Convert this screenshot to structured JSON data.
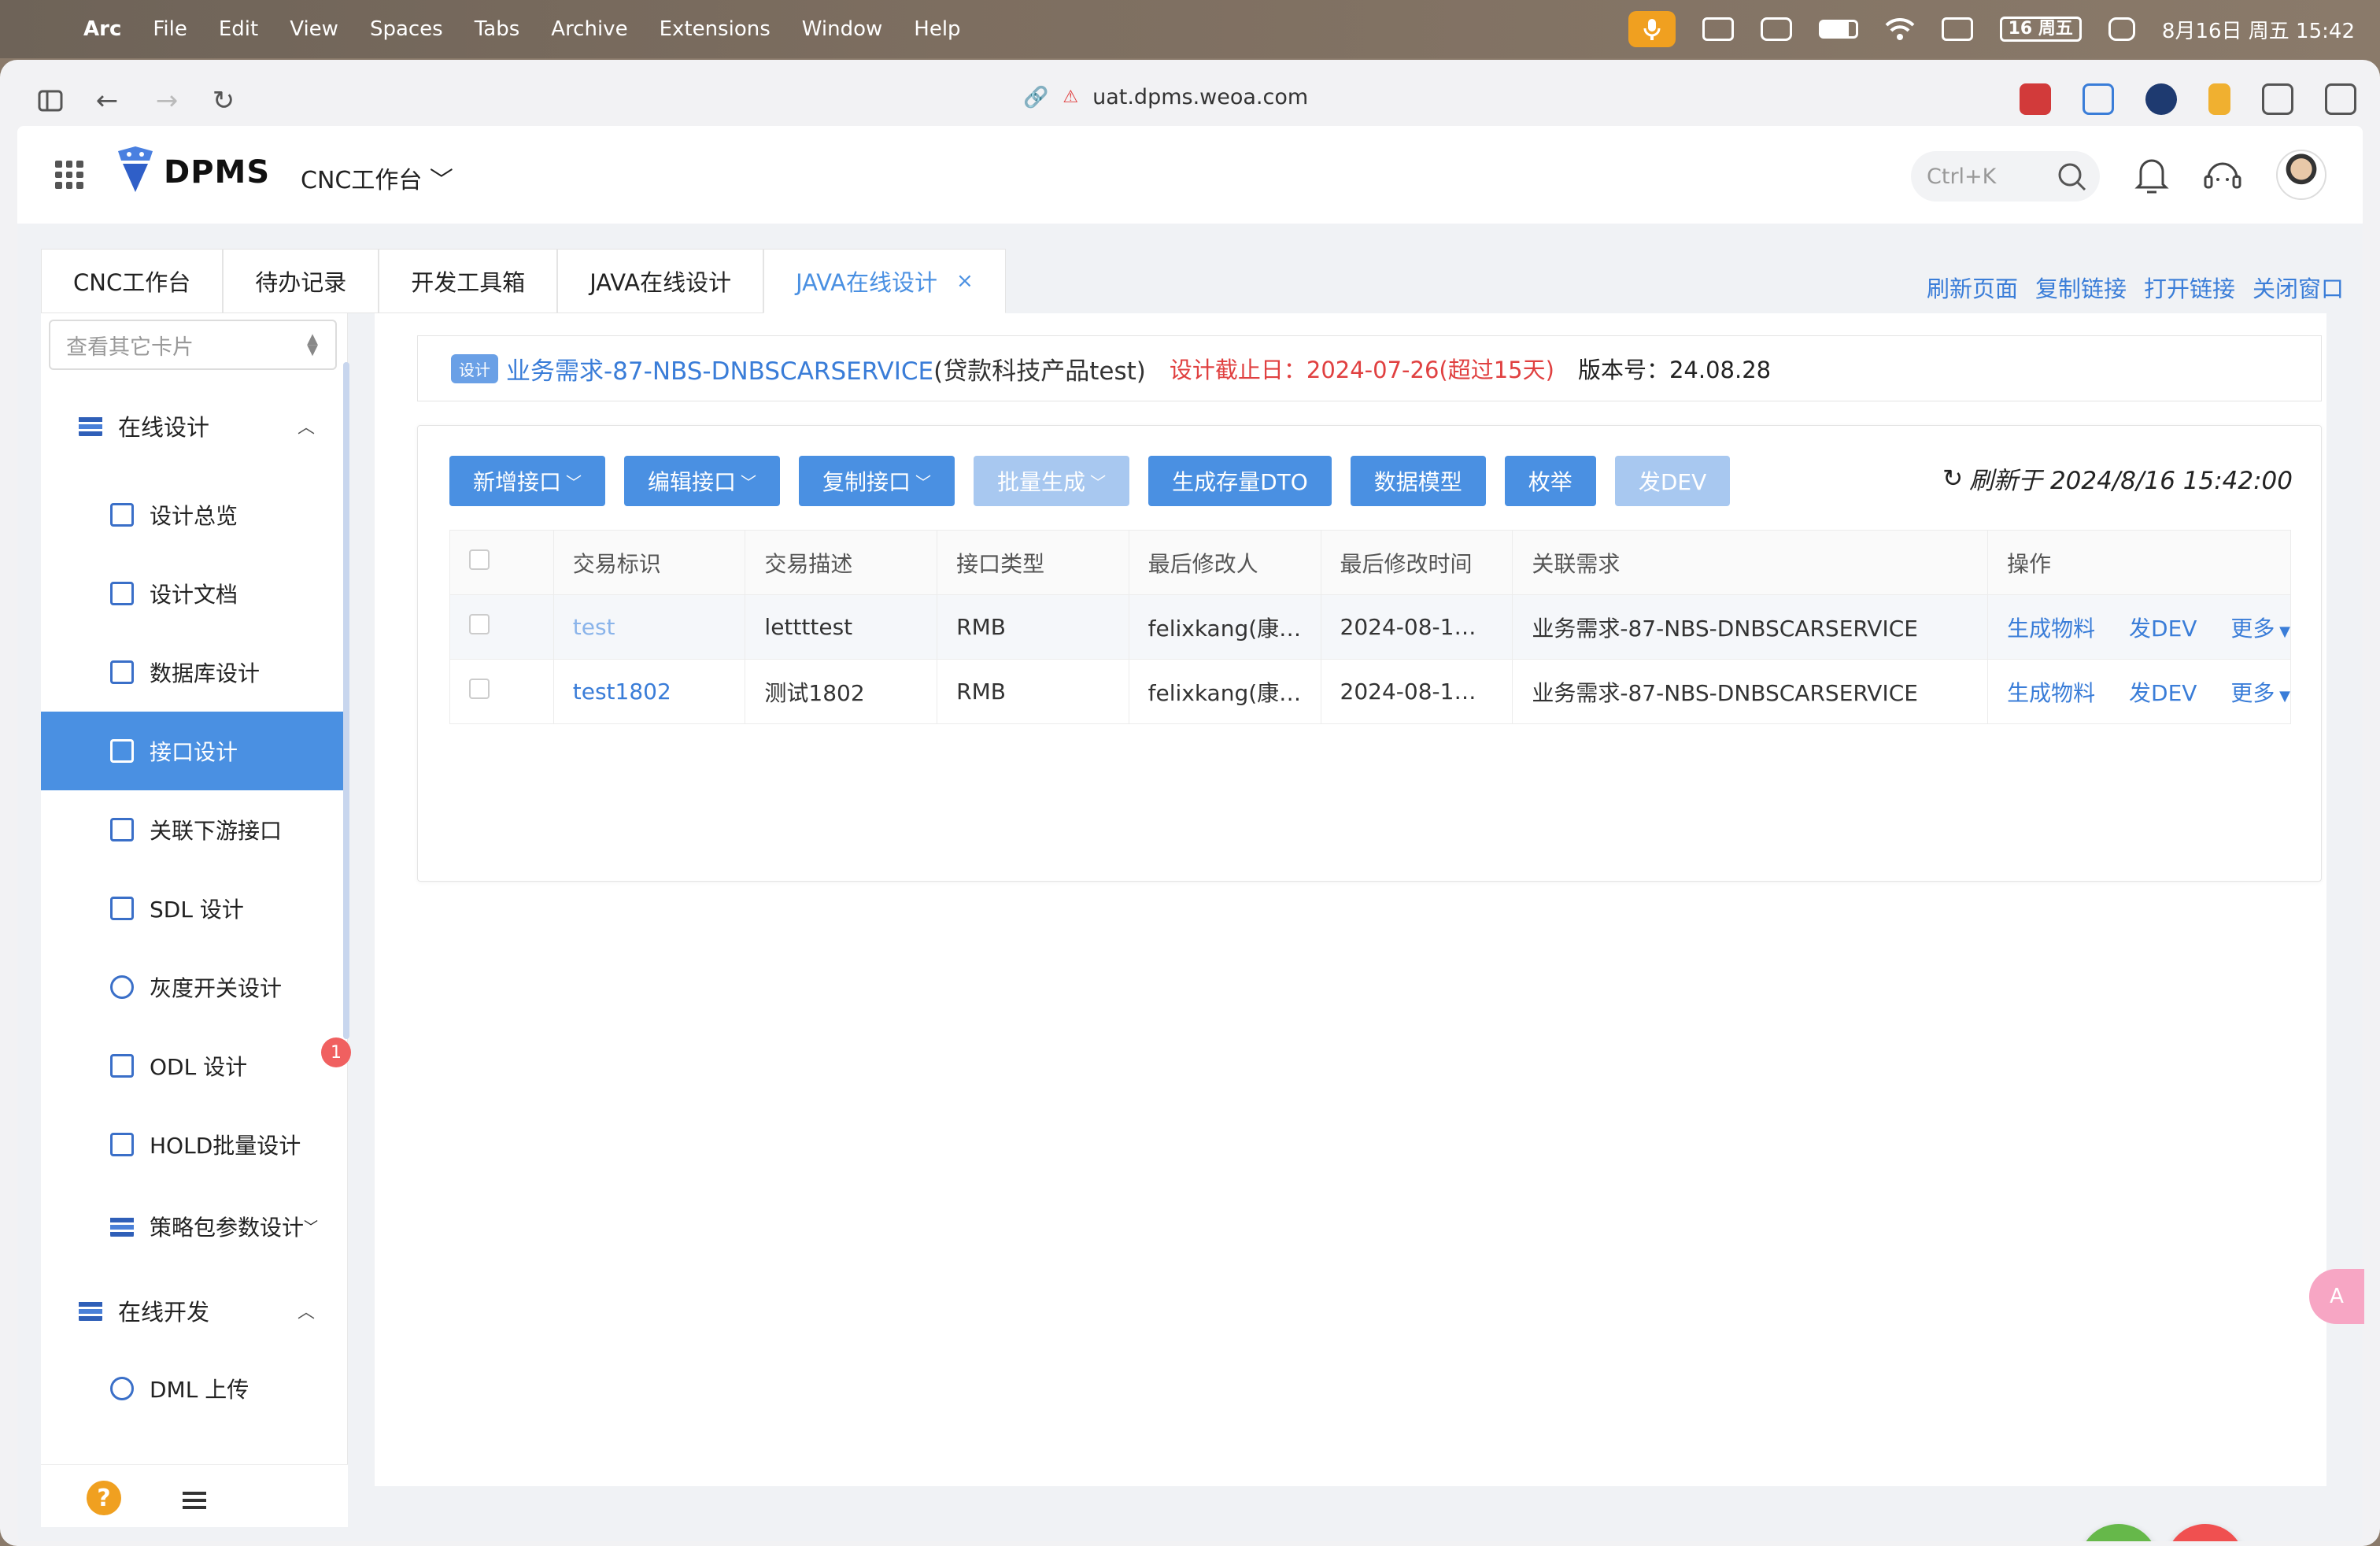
{
  "menubar": {
    "app": "Arc",
    "items": [
      "File",
      "Edit",
      "View",
      "Spaces",
      "Tabs",
      "Archive",
      "Extensions",
      "Window",
      "Help"
    ],
    "calendar_badge": "16 周五",
    "datetime": "8月16日 周五 15:42"
  },
  "browser": {
    "url": "uat.dpms.weoa.com"
  },
  "app": {
    "brand": "DPMS",
    "workspace": "CNC工作台",
    "search_placeholder": "Ctrl+K"
  },
  "tabs": [
    {
      "label": "CNC工作台"
    },
    {
      "label": "待办记录"
    },
    {
      "label": "开发工具箱"
    },
    {
      "label": "JAVA在线设计"
    },
    {
      "label": "JAVA在线设计",
      "active": true,
      "close": "×"
    }
  ],
  "tab_actions": [
    "刷新页面",
    "复制链接",
    "打开链接",
    "关闭窗口"
  ],
  "sidebar": {
    "card_select_placeholder": "查看其它卡片",
    "group1": "在线设计",
    "items": [
      {
        "label": "设计总览",
        "icon": "folder-icon"
      },
      {
        "label": "设计文档",
        "icon": "document-icon"
      },
      {
        "label": "数据库设计",
        "icon": "database-chart-icon"
      },
      {
        "label": "接口设计",
        "icon": "interface-chart-icon",
        "selected": true
      },
      {
        "label": "关联下游接口",
        "icon": "building-icon"
      },
      {
        "label": "SDL 设计",
        "icon": "sdl-icon"
      },
      {
        "label": "灰度开关设计",
        "icon": "user-icon"
      },
      {
        "label": "ODL 设计",
        "icon": "copy-icon",
        "badge": "1"
      },
      {
        "label": "HOLD批量设计",
        "icon": "list-doc-icon"
      },
      {
        "label": "策略包参数设计",
        "icon": "layers-icon"
      }
    ],
    "group2": "在线开发",
    "items2": [
      {
        "label": "DML 上传",
        "icon": "database-icon"
      }
    ],
    "help": "?"
  },
  "requirement": {
    "tag": "设计",
    "title": "业务需求-87-NBS-DNBSCARSERVICE",
    "org": "(贷款科技产品test)",
    "deadline": "设计截止日：2024-07-26(超过15天)",
    "version": "版本号：24.08.28"
  },
  "toolbar": {
    "buttons": [
      {
        "label": "新增接口",
        "dropdown": true,
        "disabled": false
      },
      {
        "label": "编辑接口",
        "dropdown": true,
        "disabled": false
      },
      {
        "label": "复制接口",
        "dropdown": true,
        "disabled": false
      },
      {
        "label": "批量生成",
        "dropdown": true,
        "disabled": true
      },
      {
        "label": "生成存量DTO",
        "dropdown": false,
        "disabled": false
      },
      {
        "label": "数据模型",
        "dropdown": false,
        "disabled": false
      },
      {
        "label": "枚举",
        "dropdown": false,
        "disabled": false
      },
      {
        "label": "发DEV",
        "dropdown": false,
        "disabled": true
      }
    ],
    "refresh": "刷新于 2024/8/16 15:42:00"
  },
  "table": {
    "headers": [
      "交易标识",
      "交易描述",
      "接口类型",
      "最后修改人",
      "最后修改时间",
      "关联需求",
      "操作"
    ],
    "rows": [
      {
        "id": "test",
        "desc": "lettttest",
        "type": "RMB",
        "modifier": "felixkang(康…",
        "time": "2024-08-1…",
        "req": "业务需求-87-NBS-DNBSCARSERVICE",
        "ops": [
          "生成物料",
          "发DEV",
          "更多"
        ]
      },
      {
        "id": "test1802",
        "desc": "测试1802",
        "type": "RMB",
        "modifier": "felixkang(康…",
        "time": "2024-08-1…",
        "req": "业务需求-87-NBS-DNBSCARSERVICE",
        "ops": [
          "生成物料",
          "发DEV",
          "更多"
        ]
      }
    ]
  },
  "colors": {
    "primary": "#4a90e2",
    "disabled": "#a8c8f0",
    "danger": "#e04040",
    "success": "#66b84a"
  }
}
